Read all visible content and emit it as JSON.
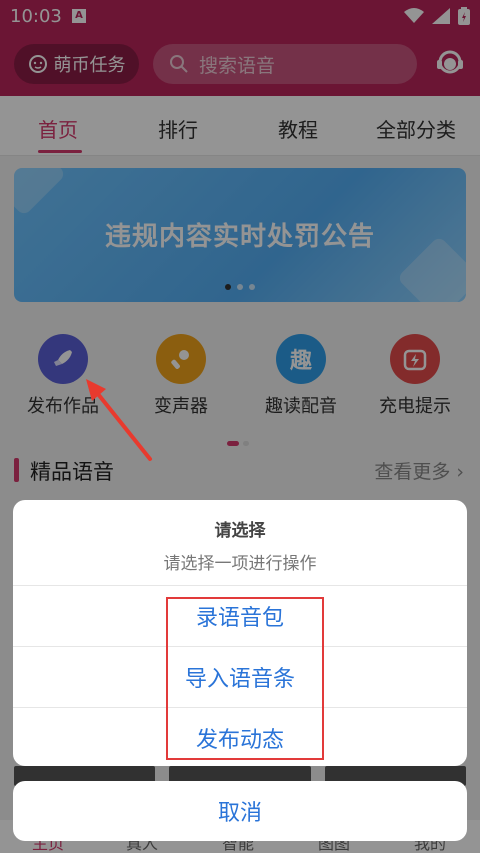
{
  "status_bar": {
    "time": "10:03",
    "badge": "A"
  },
  "header": {
    "task_button": "萌币任务",
    "search_placeholder": "搜索语音"
  },
  "tabs": [
    {
      "label": "首页",
      "active": true
    },
    {
      "label": "排行",
      "active": false
    },
    {
      "label": "教程",
      "active": false
    },
    {
      "label": "全部分类",
      "active": false
    }
  ],
  "banner": {
    "text": "违规内容实时处罚公告"
  },
  "quick_actions": [
    {
      "label": "发布作品",
      "icon": "rocket-icon",
      "color": "#5b5fd6"
    },
    {
      "label": "变声器",
      "icon": "microphone-icon",
      "color": "#f0a21b"
    },
    {
      "label": "趣读配音",
      "icon": "qu-character-icon",
      "color": "#2f9ee8"
    },
    {
      "label": "充电提示",
      "icon": "battery-charge-icon",
      "color": "#e24b4b"
    }
  ],
  "section": {
    "title": "精品语音",
    "more": "查看更多 ›"
  },
  "bottom_nav": [
    {
      "label": "主页",
      "active": true
    },
    {
      "label": "真人",
      "active": false
    },
    {
      "label": "智能",
      "active": false
    },
    {
      "label": "图图",
      "active": false
    },
    {
      "label": "我的",
      "active": false
    }
  ],
  "sheet": {
    "title": "请选择",
    "subtitle": "请选择一项进行操作",
    "options": [
      "录语音包",
      "导入语音条",
      "发布动态"
    ],
    "cancel": "取消"
  },
  "colors": {
    "brand": "#b8255a",
    "accent": "#d43a6d",
    "link": "#2a74d8",
    "highlight": "#e23a3a"
  }
}
